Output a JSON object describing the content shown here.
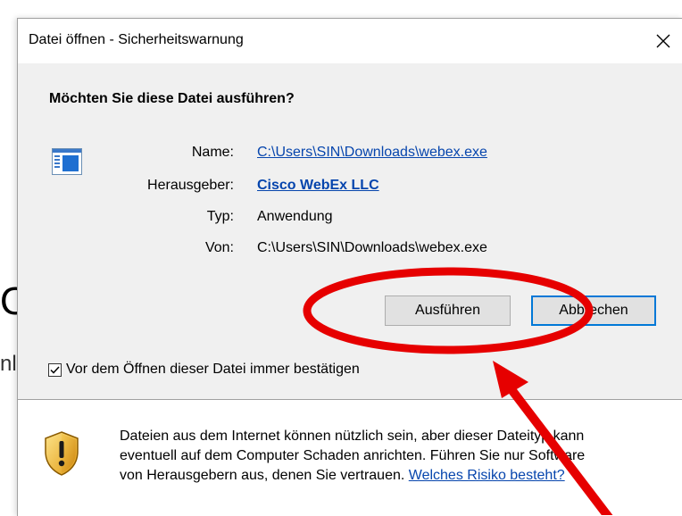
{
  "background": {
    "fragment_1": "O",
    "fragment_2": "nl"
  },
  "dialog": {
    "title": "Datei öffnen - Sicherheitswarnung",
    "heading": "Möchten Sie diese Datei ausführen?",
    "file_icon": "application-window-icon",
    "fields": [
      {
        "label": "Name:",
        "value": "C:\\Users\\SIN\\Downloads\\webex.exe",
        "style": "link"
      },
      {
        "label": "Herausgeber:",
        "value": "Cisco WebEx LLC",
        "style": "link-bold"
      },
      {
        "label": "Typ:",
        "value": "Anwendung",
        "style": "text"
      },
      {
        "label": "Von:",
        "value": "C:\\Users\\SIN\\Downloads\\webex.exe",
        "style": "text"
      }
    ],
    "buttons": {
      "run": "Ausführen",
      "cancel": "Abbrechen"
    },
    "checkbox": {
      "label": "Vor dem Öffnen dieser Datei immer bestätigen",
      "checked": true
    },
    "footer": {
      "icon": "shield-warning-icon",
      "line_1": "Dateien aus dem Internet können nützlich sein, aber dieser Dateityp kann",
      "line_2": "eventuell auf dem Computer Schaden anrichten. Führen Sie nur Software",
      "line_3_text": "von Herausgebern aus, denen Sie vertrauen. ",
      "link": "Welches Risiko besteht?"
    }
  },
  "annotation": {
    "type": "red-ellipse-and-arrow",
    "color": "#e60000",
    "highlights": "Ausführen"
  }
}
